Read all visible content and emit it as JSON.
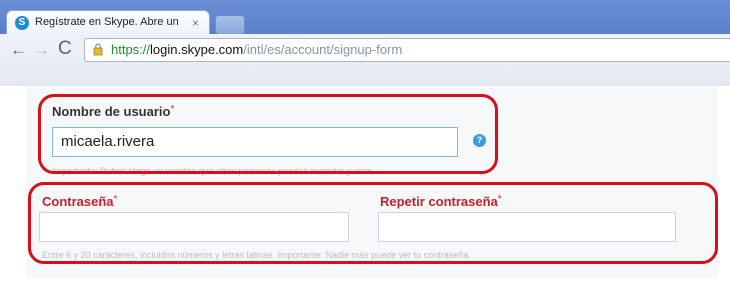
{
  "browser": {
    "tab_title": "Regístrate en Skype. Abre un",
    "tab_close": "×",
    "url_protocol": "https://",
    "url_host": "login.skype.com",
    "url_path": "/intl/es/account/signup-form",
    "back_glyph": "←",
    "forward_glyph": "→",
    "reload_glyph": "C"
  },
  "form": {
    "username": {
      "label": "Nombre de usuario",
      "required_mark": "*",
      "value": "micaela.rivera",
      "hint": "Importante: Debes elegir un nombre que otras personas puedan recordar y usar.",
      "help_glyph": "?"
    },
    "password": {
      "label": "Contraseña",
      "required_mark": "*",
      "value": ""
    },
    "repeat_password": {
      "label": "Repetir contraseña",
      "required_mark": "*",
      "value": ""
    },
    "password_hint": "Entre 6 y 20 caracteres, incluidos números y letras latinas. Importante: Nadie más puede ver tu contraseña."
  },
  "colors": {
    "highlight": "#d6101a",
    "label_red": "#c6212a",
    "secure_green": "#1a8f2e"
  },
  "icons": {
    "favicon": "skype-icon",
    "lock": "lock-icon",
    "help": "help-icon"
  }
}
